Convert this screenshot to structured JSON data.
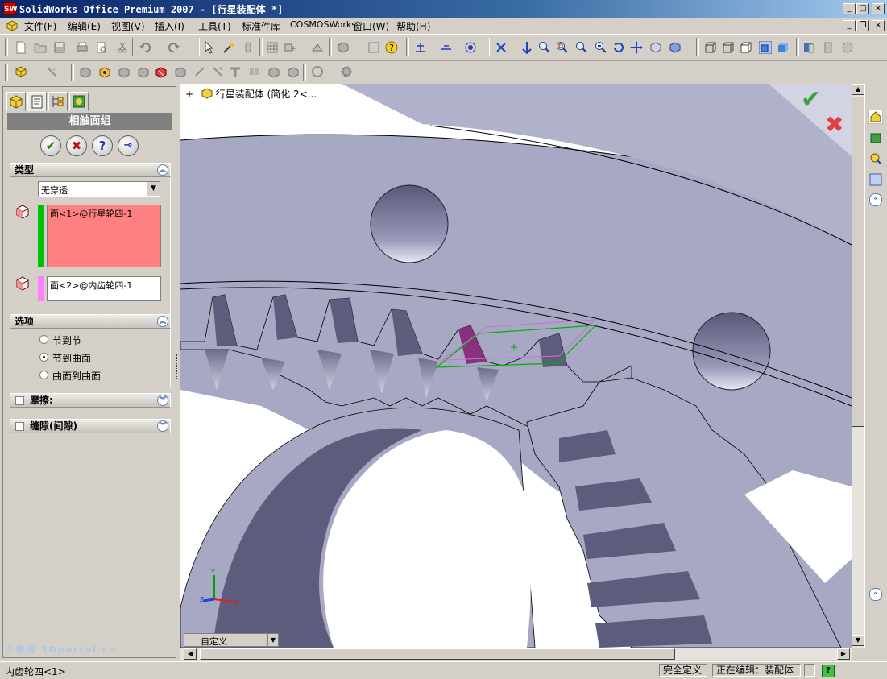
{
  "window": {
    "title": "SolidWorks Office Premium 2007 - [行星装配体 *]",
    "app_icon_text": "SW",
    "controls": {
      "minimize": "_",
      "maximize": "□",
      "close": "×",
      "doc_restore": "❐"
    }
  },
  "menu": {
    "items": [
      "文件(F)",
      "编辑(E)",
      "视图(V)",
      "插入(I)",
      "工具(T)",
      "标准件库",
      "COSMOSWorks",
      "窗口(W)",
      "帮助(H)"
    ]
  },
  "property_manager": {
    "title": "相触面组",
    "buttons": {
      "ok": "✔",
      "cancel": "✖",
      "help": "?",
      "pin": "⊸"
    },
    "type_group": {
      "header": "类型",
      "select_value": "无穿透",
      "face1": "面<1>@行星轮四-1",
      "face2": "面<2>@内齿轮四-1",
      "face1_color": "#ff8080",
      "face1_bar_color": "#00c000",
      "face2_bar_color": "#ff80ff"
    },
    "options_group": {
      "header": "选项",
      "options": [
        "节到节",
        "节到曲面",
        "曲面到曲面"
      ],
      "selected": "节到曲面"
    },
    "friction": {
      "label": "摩擦:",
      "checked": false
    },
    "clearance": {
      "label": "缝隙(间隙)",
      "checked": false
    }
  },
  "viewport": {
    "breadcrumb_expand": "+",
    "breadcrumb": "行星装配体  (简化  2<...",
    "config_label": "自定义",
    "confirm_ok": "✔",
    "confirm_cancel": "✖",
    "triad": {
      "x": "X",
      "y": "Y",
      "z": "Z"
    }
  },
  "statusbar": {
    "left": "内齿轮四<1>",
    "state": "完全定义",
    "editing": "正在编辑：装配体",
    "help_icon": "?"
  },
  "watermark": "三维网 3Dportal.cn",
  "colors": {
    "gear_face": "#a6a8c4",
    "gear_shadow": "#5e5c7c",
    "background_white": "#ffffff",
    "selection_green": "#00b000",
    "selection_magenta": "#d070d0"
  }
}
